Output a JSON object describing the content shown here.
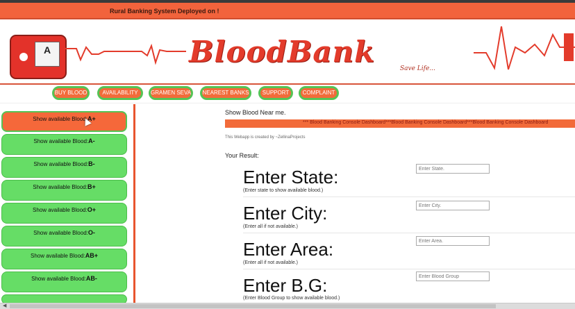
{
  "marquee": {
    "text": "Rural Banking System Deployed on !"
  },
  "banner": {
    "logo_text": "BloodBank",
    "tagline": "Save Life...",
    "bag_label": "A"
  },
  "nav": {
    "items": [
      {
        "label": "BUY BLOOD"
      },
      {
        "label": "AVAILABILITY"
      },
      {
        "label": "GRAMEN SEVA"
      },
      {
        "label": "NEAREST BANKS"
      },
      {
        "label": "SUPPORT"
      },
      {
        "label": "COMPLAINT"
      }
    ]
  },
  "sidebar": {
    "items": [
      {
        "label": "Show available Blood:",
        "group": "A+",
        "active": true
      },
      {
        "label": "Show available Blood:",
        "group": "A-",
        "active": false
      },
      {
        "label": "Show available Blood:",
        "group": "B-",
        "active": false
      },
      {
        "label": "Show available Blood:",
        "group": "B+",
        "active": false
      },
      {
        "label": "Show available Blood:",
        "group": "O+",
        "active": false
      },
      {
        "label": "Show available Blood:",
        "group": "O-",
        "active": false
      },
      {
        "label": "Show available Blood:",
        "group": "AB+",
        "active": false
      },
      {
        "label": "Show available Blood:",
        "group": "AB-",
        "active": false
      }
    ]
  },
  "main": {
    "title": "Show Blood Near me.",
    "ticker": "*** Blood Banking Console Dashboard***Blood Banking Console Dashboard***Blood Banking Console Dashboard",
    "credit": "This Webapp is created by ~ZellinaProjects",
    "result_label": "Your Result:",
    "fields": [
      {
        "title": "Enter State:",
        "hint": "(Enter state to show available blood.)",
        "placeholder": "Enter State."
      },
      {
        "title": "Enter City:",
        "hint": "(Enter all if not available.)",
        "placeholder": "Enter City."
      },
      {
        "title": "Enter Area:",
        "hint": "(Enter all if not available.)",
        "placeholder": "Enter Area."
      },
      {
        "title": "Enter B.G:",
        "hint": "(Enter Blood Group to show available blood.)",
        "placeholder": "Enter Blood Group"
      }
    ]
  },
  "colors": {
    "accent_orange": "#f2633c",
    "button_green": "#66dd66",
    "logo_red": "#e33b2b"
  }
}
